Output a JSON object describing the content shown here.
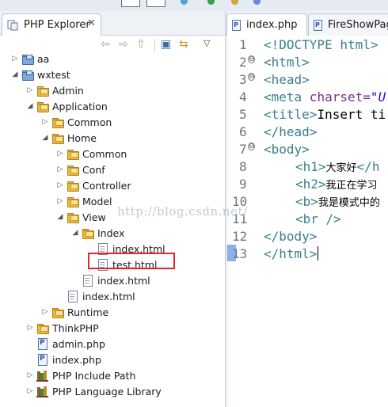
{
  "explorer": {
    "tab_label": "PHP Explorer",
    "tree": [
      {
        "label": "aa",
        "icon": "project-folder-icon"
      },
      {
        "label": "wxtest",
        "icon": "project-folder-icon"
      },
      {
        "label": "Admin",
        "icon": "package-folder-icon"
      },
      {
        "label": "Application",
        "icon": "package-folder-icon"
      },
      {
        "label": "Common",
        "icon": "package-folder-icon"
      },
      {
        "label": "Home",
        "icon": "package-folder-icon"
      },
      {
        "label": "Common",
        "icon": "package-folder-icon"
      },
      {
        "label": "Conf",
        "icon": "package-folder-icon"
      },
      {
        "label": "Controller",
        "icon": "package-folder-icon"
      },
      {
        "label": "Model",
        "icon": "package-folder-icon"
      },
      {
        "label": "View",
        "icon": "package-folder-icon"
      },
      {
        "label": "Index",
        "icon": "package-folder-icon"
      },
      {
        "label": "index.html",
        "icon": "html-file-icon"
      },
      {
        "label": "test.html",
        "icon": "html-file-icon"
      },
      {
        "label": "index.html",
        "icon": "html-file-icon"
      },
      {
        "label": "index.html",
        "icon": "html-file-icon"
      },
      {
        "label": "Runtime",
        "icon": "package-folder-icon"
      },
      {
        "label": "ThinkPHP",
        "icon": "package-folder-icon"
      },
      {
        "label": "admin.php",
        "icon": "php-file-icon"
      },
      {
        "label": "index.php",
        "icon": "php-file-icon"
      },
      {
        "label": "PHP Include Path",
        "icon": "library-icon"
      },
      {
        "label": "PHP Language Library",
        "icon": "library-icon"
      }
    ]
  },
  "editor": {
    "tabs": [
      "index.php",
      "FireShowPag"
    ],
    "line_numbers": [
      "1",
      "2",
      "3",
      "4",
      "5",
      "6",
      "7",
      "8",
      "9",
      "10",
      "11",
      "12",
      "13"
    ],
    "lines": {
      "l1_tag": "<!DOCTYPE html>",
      "l2_tag": "<html>",
      "l3_tag": "<head>",
      "l4_tag": "<meta",
      "l4_attr": " charset=",
      "l4_val": "\"U",
      "l5_tag": "<title>",
      "l5_text": "Insert ti",
      "l6_tag": "</head>",
      "l7_tag": "<body>",
      "l8_tag": "<h1>",
      "l8_text": "大家好",
      "l8_tag2": "</h",
      "l9_tag": "<h2>",
      "l9_text": "我正在学习",
      "l10_tag": "<b>",
      "l10_text": "我是模式中的",
      "l11_tag": "<br />",
      "l12_tag": "</body>",
      "l13_tag": "</html>"
    }
  },
  "watermark": "http://blog.csdn.net/",
  "colors": {
    "highlight": "#e3262b",
    "tag": "#3a7f8c",
    "marker": "#8bb2e3"
  }
}
